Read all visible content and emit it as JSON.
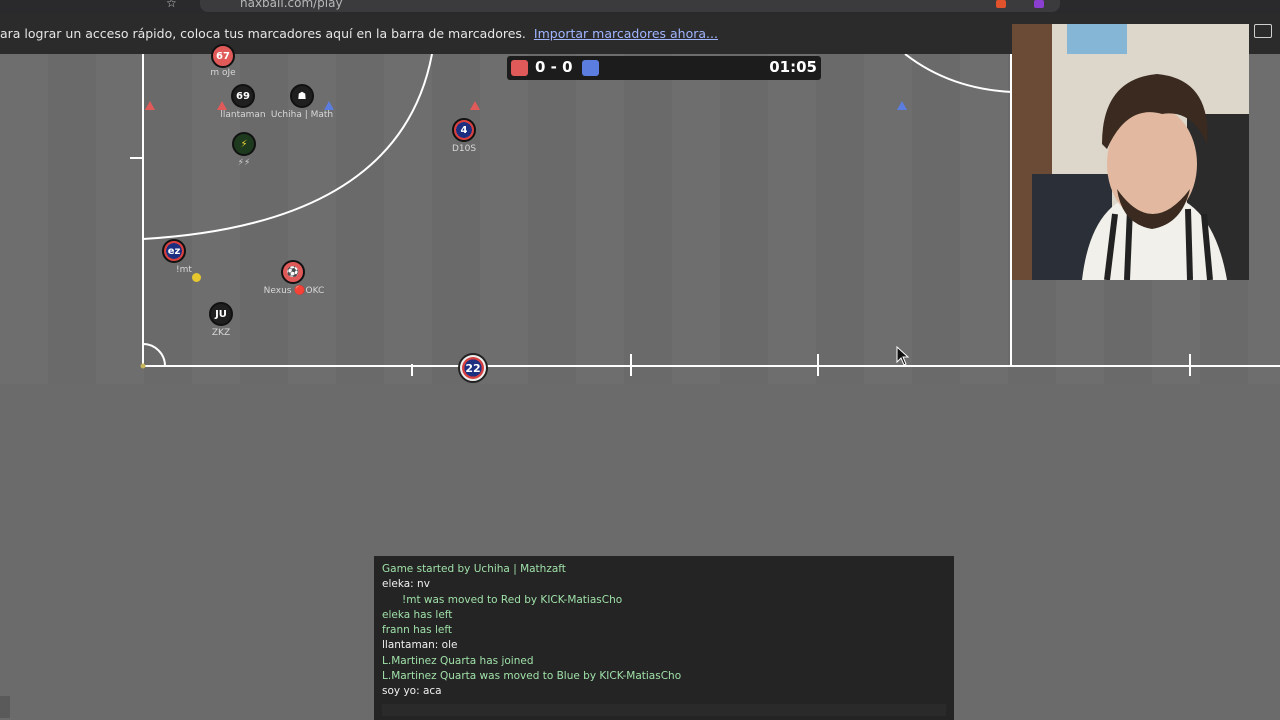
{
  "browser": {
    "url_text": "haxball.com/play",
    "bookmarks_message": "ara lograr un acceso rápido, coloca tus marcadores aquí en la barra de marcadores.",
    "bookmarks_link": "Importar marcadores ahora..."
  },
  "scoreboard": {
    "red_score": "0",
    "separator": "-",
    "blue_score": "0",
    "score_text": "0 - 0",
    "timer": "01:05",
    "red_color": "#e05a5a",
    "blue_color": "#5b7de0"
  },
  "players": [
    {
      "label": "67",
      "name": "m oJe",
      "team": "red"
    },
    {
      "label": "69",
      "name": "llantaman",
      "team": "black"
    },
    {
      "label": "☗",
      "name": "Uchiha | Math",
      "team": "black"
    },
    {
      "label": "⚡",
      "name": "⚡⚡",
      "team": "black"
    },
    {
      "label": "4",
      "name": "D10S",
      "team": "red"
    },
    {
      "label": "ez",
      "name": "!mt",
      "team": "redblue"
    },
    {
      "label": "⚽",
      "name": "Nexus 🔴OKC",
      "team": "red"
    },
    {
      "label": "JU",
      "name": "ZKZ",
      "team": "black"
    }
  ],
  "ball": {
    "label": "22"
  },
  "chat": {
    "lines": [
      {
        "text": "Game started by Uchiha | Mathzaft",
        "type": "sys"
      },
      {
        "text": "eleka: nv",
        "type": "usr"
      },
      {
        "text": "!mt was moved to Red by KICK-MatiasCho",
        "type": "sys"
      },
      {
        "text": "eleka has left",
        "type": "sys"
      },
      {
        "text": "frann has left",
        "type": "sys"
      },
      {
        "text": "llantaman: ole",
        "type": "usr"
      },
      {
        "text": "L.Martinez Quarta has joined",
        "type": "sys"
      },
      {
        "text": "L.Martinez Quarta was moved to Blue by KICK-MatiasCho",
        "type": "sys"
      },
      {
        "text": "soy yo: aca",
        "type": "usr"
      }
    ],
    "input_value": ""
  }
}
